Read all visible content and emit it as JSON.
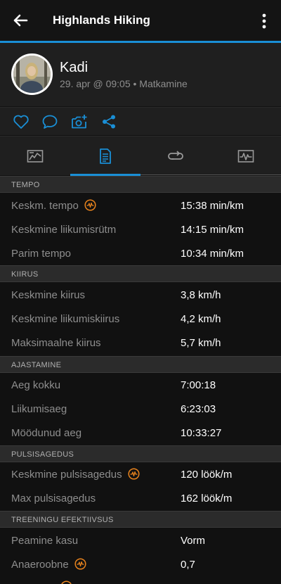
{
  "appbar": {
    "title": "Highlands Hiking"
  },
  "profile": {
    "name": "Kadi",
    "meta": "29. apr @ 09:05 • Matkamine"
  },
  "actions": [
    "heart-icon",
    "comment-icon",
    "add-photo-icon",
    "share-icon"
  ],
  "tabs": [
    {
      "icon": "summary-icon",
      "active": false
    },
    {
      "icon": "details-icon",
      "active": true
    },
    {
      "icon": "laps-icon",
      "active": false
    },
    {
      "icon": "charts-icon",
      "active": false
    }
  ],
  "colors": {
    "accent": "#1a8fd6",
    "badge": "#e8831d",
    "background": "#111111",
    "panel": "#1f1f1f"
  },
  "sections": {
    "tempo": {
      "header": "TEMPO",
      "rows": [
        {
          "label": "Keskm. tempo",
          "value": "15:38 min/km",
          "badge": true
        },
        {
          "label": "Keskmine liikumisrütm",
          "value": "14:15 min/km"
        },
        {
          "label": "Parim tempo",
          "value": "10:34 min/km"
        }
      ]
    },
    "kiirus": {
      "header": "KIIRUS",
      "rows": [
        {
          "label": "Keskmine kiirus",
          "value": "3,8 km/h"
        },
        {
          "label": "Keskmine liikumiskiirus",
          "value": "4,2 km/h"
        },
        {
          "label": "Maksimaalne kiirus",
          "value": "5,7 km/h"
        }
      ]
    },
    "ajastamine": {
      "header": "AJASTAMINE",
      "rows": [
        {
          "label": "Aeg kokku",
          "value": "7:00:18"
        },
        {
          "label": "Liikumisaeg",
          "value": "6:23:03"
        },
        {
          "label": "Möödunud aeg",
          "value": "10:33:27"
        }
      ]
    },
    "pulss": {
      "header": "PULSISAGEDUS",
      "rows": [
        {
          "label": "Keskmine pulsisagedus",
          "value": "120 löök/m",
          "badge": true
        },
        {
          "label": "Max pulsisagedus",
          "value": "162 löök/m"
        }
      ]
    },
    "treening": {
      "header": "TREENINGU EFEKTIIVSUS",
      "rows": [
        {
          "label": "Peamine kasu",
          "value": "Vorm"
        },
        {
          "label": "Anaeroobne",
          "value": "0,7",
          "badge": true
        }
      ]
    }
  }
}
